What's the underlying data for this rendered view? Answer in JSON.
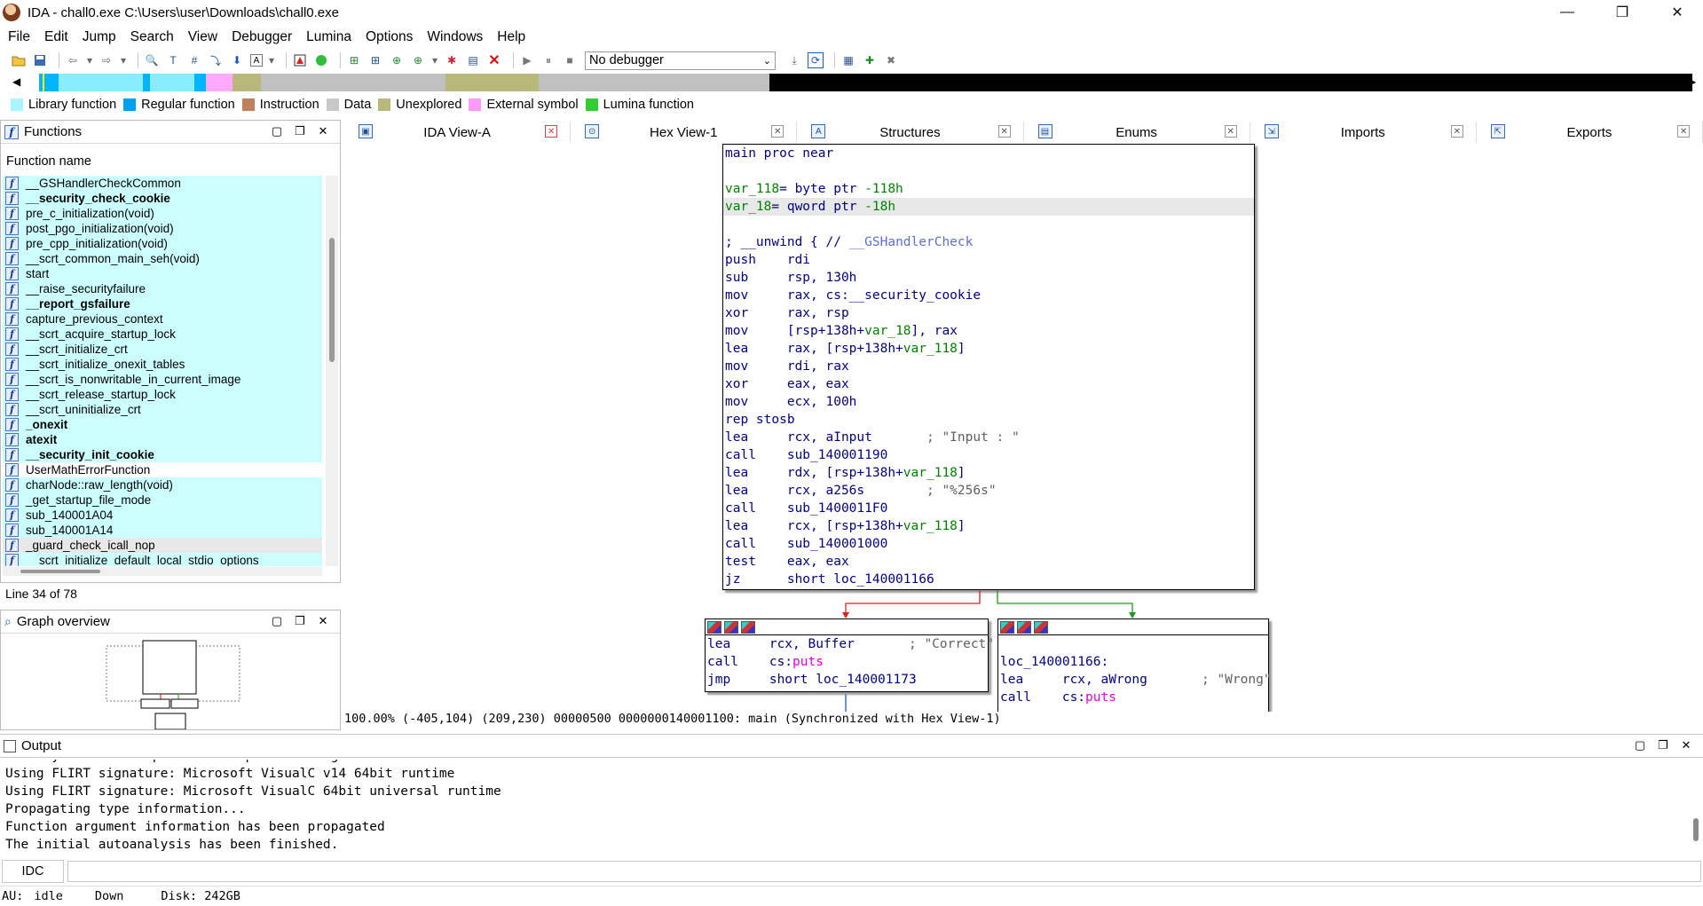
{
  "window": {
    "title": "IDA - chall0.exe C:\\Users\\user\\Downloads\\chall0.exe",
    "minimize": "—",
    "maximize": "❐",
    "close": "✕"
  },
  "menu": [
    "File",
    "Edit",
    "Jump",
    "Search",
    "View",
    "Debugger",
    "Lumina",
    "Options",
    "Windows",
    "Help"
  ],
  "toolbar": {
    "debugger_select": "No debugger"
  },
  "nav_band": {
    "segments": [
      {
        "color": "#00b4ff",
        "from": 0,
        "to": 0.012
      },
      {
        "color": "#88eeff",
        "from": 0.012,
        "to": 0.063
      },
      {
        "color": "#00b4ff",
        "from": 0.063,
        "to": 0.067
      },
      {
        "color": "#88eeff",
        "from": 0.067,
        "to": 0.094
      },
      {
        "color": "#00b4ff",
        "from": 0.094,
        "to": 0.101
      },
      {
        "color": "#ffaaff",
        "from": 0.101,
        "to": 0.117
      },
      {
        "color": "#b8b87a",
        "from": 0.117,
        "to": 0.134
      },
      {
        "color": "#c0c0c0",
        "from": 0.134,
        "to": 0.246
      },
      {
        "color": "#b8b87a",
        "from": 0.246,
        "to": 0.302
      },
      {
        "color": "#c0c0c0",
        "from": 0.302,
        "to": 0.442
      },
      {
        "color": "#000000",
        "from": 0.442,
        "to": 1
      }
    ]
  },
  "legend": [
    {
      "label": "Library function",
      "color": "#aaf5ff"
    },
    {
      "label": "Regular function",
      "color": "#00a0f0"
    },
    {
      "label": "Instruction",
      "color": "#c08060"
    },
    {
      "label": "Data",
      "color": "#c8c8c8"
    },
    {
      "label": "Unexplored",
      "color": "#b8b87a"
    },
    {
      "label": "External symbol",
      "color": "#ff99ff"
    },
    {
      "label": "Lumina function",
      "color": "#33cc33"
    }
  ],
  "functions_panel": {
    "title": "Functions",
    "column": "Function name",
    "items": [
      {
        "name": "__GSHandlerCheckCommon",
        "bold": false
      },
      {
        "name": "__security_check_cookie",
        "bold": true
      },
      {
        "name": "pre_c_initialization(void)",
        "bold": false
      },
      {
        "name": "post_pgo_initialization(void)",
        "bold": false
      },
      {
        "name": "pre_cpp_initialization(void)",
        "bold": false
      },
      {
        "name": "__scrt_common_main_seh(void)",
        "bold": false
      },
      {
        "name": "start",
        "bold": false
      },
      {
        "name": "__raise_securityfailure",
        "bold": false
      },
      {
        "name": "__report_gsfailure",
        "bold": true
      },
      {
        "name": "capture_previous_context",
        "bold": false
      },
      {
        "name": "__scrt_acquire_startup_lock",
        "bold": false
      },
      {
        "name": "__scrt_initialize_crt",
        "bold": false
      },
      {
        "name": "__scrt_initialize_onexit_tables",
        "bold": false
      },
      {
        "name": "__scrt_is_nonwritable_in_current_image",
        "bold": false
      },
      {
        "name": "__scrt_release_startup_lock",
        "bold": false
      },
      {
        "name": "__scrt_uninitialize_crt",
        "bold": false
      },
      {
        "name": "_onexit",
        "bold": true
      },
      {
        "name": "atexit",
        "bold": true
      },
      {
        "name": "__security_init_cookie",
        "bold": true
      },
      {
        "name": "UserMathErrorFunction",
        "bold": false
      },
      {
        "name": "charNode::raw_length(void)",
        "bold": false
      },
      {
        "name": "_get_startup_file_mode",
        "bold": false
      },
      {
        "name": "sub_140001A04",
        "bold": false
      },
      {
        "name": "sub_140001A14",
        "bold": false
      },
      {
        "name": "_guard_check_icall_nop",
        "bold": false
      },
      {
        "name": "__scrt_initialize_default_local_stdio_options",
        "bold": false
      }
    ],
    "status": "Line 34 of 78"
  },
  "graph_overview": {
    "title": "Graph overview"
  },
  "tabs": [
    {
      "label": "IDA View-A",
      "icon": "ida-view-icon",
      "active": true
    },
    {
      "label": "Hex View-1",
      "icon": "hex-view-icon",
      "active": false
    },
    {
      "label": "Structures",
      "icon": "structures-icon",
      "active": false
    },
    {
      "label": "Enums",
      "icon": "enums-icon",
      "active": false
    },
    {
      "label": "Imports",
      "icon": "imports-icon",
      "active": false
    },
    {
      "label": "Exports",
      "icon": "exports-icon",
      "active": false
    }
  ],
  "main_block": [
    {
      "op": "main proc near",
      "args": "",
      "cmt": ""
    },
    {
      "op": "",
      "args": "",
      "cmt": ""
    },
    {
      "op": "var_118= byte ptr -118h",
      "args": "",
      "cmt": "",
      "kind": "var"
    },
    {
      "op": "var_18= qword ptr -18h",
      "args": "",
      "cmt": "",
      "kind": "var",
      "hl": true
    },
    {
      "op": "",
      "args": "",
      "cmt": ""
    },
    {
      "op": "; __unwind { // __GSHandlerCheck",
      "args": "",
      "cmt": "",
      "kind": "unwind"
    },
    {
      "op": "push",
      "args": "rdi",
      "cmt": ""
    },
    {
      "op": "sub",
      "args": "rsp, 130h",
      "cmt": ""
    },
    {
      "op": "mov",
      "args": "rax, cs:__security_cookie",
      "cmt": ""
    },
    {
      "op": "xor",
      "args": "rax, rsp",
      "cmt": ""
    },
    {
      "op": "mov",
      "args": "[rsp+138h+var_18], rax",
      "cmt": ""
    },
    {
      "op": "lea",
      "args": "rax, [rsp+138h+var_118]",
      "cmt": ""
    },
    {
      "op": "mov",
      "args": "rdi, rax",
      "cmt": ""
    },
    {
      "op": "xor",
      "args": "eax, eax",
      "cmt": ""
    },
    {
      "op": "mov",
      "args": "ecx, 100h",
      "cmt": ""
    },
    {
      "op": "rep stosb",
      "args": "",
      "cmt": ""
    },
    {
      "op": "lea",
      "args": "rcx, aInput",
      "cmt": "; \"Input : \""
    },
    {
      "op": "call",
      "args": "sub_140001190",
      "cmt": ""
    },
    {
      "op": "lea",
      "args": "rdx, [rsp+138h+var_118]",
      "cmt": ""
    },
    {
      "op": "lea",
      "args": "rcx, a256s",
      "cmt": "; \"%256s\""
    },
    {
      "op": "call",
      "args": "sub_1400011F0",
      "cmt": ""
    },
    {
      "op": "lea",
      "args": "rcx, [rsp+138h+var_118]",
      "cmt": ""
    },
    {
      "op": "call",
      "args": "sub_140001000",
      "cmt": ""
    },
    {
      "op": "test",
      "args": "eax, eax",
      "cmt": ""
    },
    {
      "op": "jz",
      "args": "short loc_140001166",
      "cmt": ""
    }
  ],
  "left_block": [
    {
      "op": "lea",
      "args": "rcx, Buffer",
      "cmt": "; \"Correct\""
    },
    {
      "op": "call",
      "args": "cs:puts",
      "cmt": ""
    },
    {
      "op": "jmp",
      "args": "short loc_140001173",
      "cmt": ""
    }
  ],
  "right_block": [
    {
      "op": "",
      "args": "",
      "cmt": ""
    },
    {
      "op": "loc_140001166:",
      "args": "",
      "cmt": ""
    },
    {
      "op": "lea",
      "args": "rcx, aWrong",
      "cmt": "; \"Wrong\""
    },
    {
      "op": "call",
      "args": "cs:puts",
      "cmt": ""
    }
  ],
  "graph_status": "100.00% (-405,104) (209,230) 00000500 0000000140001100: main (Synchronized with Hex View-1)",
  "output": {
    "title": "Output",
    "lines": [
      "You may start to explore the input file right now.",
      "Using FLIRT signature: Microsoft VisualC v14 64bit runtime",
      "Using FLIRT signature: Microsoft VisualC 64bit universal runtime",
      "Propagating type information...",
      "Function argument information has been propagated",
      "The initial autoanalysis has been finished."
    ]
  },
  "idc": {
    "label": "IDC"
  },
  "statusbar": {
    "au_label": "AU:",
    "au_state": "idle",
    "direction": "Down",
    "disk": "Disk: 242GB"
  }
}
